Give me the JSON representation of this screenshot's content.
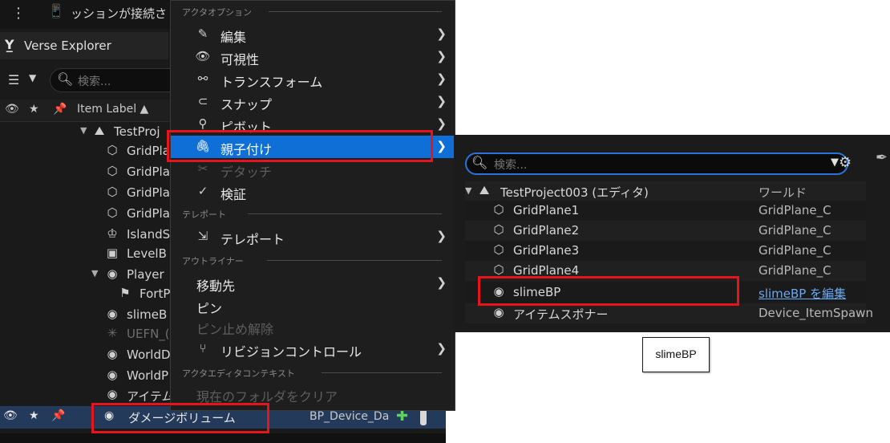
{
  "outliner": {
    "session_text": "ッションが接続さ",
    "tab_label": "Verse Explorer",
    "search_placeholder": "検索...",
    "header_item_label": "Item Label ▲",
    "rows": [
      {
        "label": "TestProj",
        "icon": "level-icon"
      },
      {
        "label": "GridPla",
        "icon": "cube-icon"
      },
      {
        "label": "GridPla",
        "icon": "cube-icon"
      },
      {
        "label": "GridPla",
        "icon": "cube-icon"
      },
      {
        "label": "GridPla",
        "icon": "cube-icon"
      },
      {
        "label": "IslandS",
        "icon": "island-icon"
      },
      {
        "label": "LevelB",
        "icon": "level-blueprint-icon"
      },
      {
        "label": "Player",
        "icon": "device-icon"
      },
      {
        "label": "FortP",
        "icon": "flag-icon"
      },
      {
        "label": "slimeB",
        "icon": "device-icon"
      },
      {
        "label": "UEFN_(",
        "icon": "light-icon"
      },
      {
        "label": "WorldD",
        "icon": "device-icon"
      },
      {
        "label": "WorldP",
        "icon": "device-icon"
      },
      {
        "label": "アイテム",
        "icon": "device-icon"
      }
    ],
    "selected_row": {
      "label": "ダメージボリューム",
      "class": "BP_Device_Da"
    }
  },
  "context_menu": {
    "sections": {
      "actor_options": "アクタオプション",
      "teleport": "テレポート",
      "outliner": "アウトライナー",
      "actor_editor_context": "アクタエディタコンテキスト"
    },
    "items": {
      "edit": "編集",
      "visibility": "可視性",
      "transform": "トランスフォーム",
      "snap": "スナップ",
      "pivot": "ピボット",
      "attach": "親子付け",
      "detach": "デタッチ",
      "verify": "検証",
      "teleport": "テレポート",
      "move_to": "移動先",
      "pin": "ピン",
      "unpin": "ピン止め解除",
      "revision_control": "リビジョンコントロール",
      "clear_folder": "現在のフォルダをクリア"
    }
  },
  "popup": {
    "search_placeholder": "検索...",
    "rows": [
      {
        "name": "TestProject003 (エディタ)",
        "type": "ワールド"
      },
      {
        "name": "GridPlane1",
        "type": "GridPlane_C"
      },
      {
        "name": "GridPlane2",
        "type": "GridPlane_C"
      },
      {
        "name": "GridPlane3",
        "type": "GridPlane_C"
      },
      {
        "name": "GridPlane4",
        "type": "GridPlane_C"
      },
      {
        "name": "slimeBP",
        "type": "slimeBP を編集"
      },
      {
        "name": "アイテムスポナー",
        "type": "Device_ItemSpawn"
      }
    ]
  },
  "tooltip_label": "slimeBP"
}
